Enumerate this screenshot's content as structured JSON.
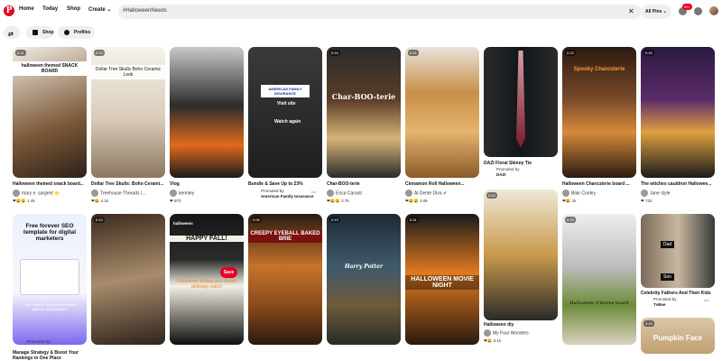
{
  "nav": {
    "home": "Home",
    "today": "Today",
    "shop": "Shop",
    "create": "Create ⌄"
  },
  "search": {
    "value": "#HalloweenNeeds",
    "clear": "✕",
    "scope": "All Pins ⌄"
  },
  "notifications": {
    "badge": "99+"
  },
  "filters": {
    "shop": "Shop",
    "profiles": "Profiles"
  },
  "pins": [
    {
      "dur": "0:11",
      "title": "Halloween themed snack board...",
      "user": "mary e. sargent 🌟",
      "react": "❤😄😮 1.4k",
      "cap": "halloween themed SNACK BOARD"
    },
    {
      "dur": "0:13",
      "title": "Dollar Tree Skulls: Boho Cerami...",
      "user": "Treehouse Threads /...",
      "react": "❤😄 4.1k",
      "cap": "Dollar Tree Skulls Boho Ceramic Look"
    },
    {
      "dur": "",
      "title": "Vlog",
      "user": "kennley",
      "react": "❤ 970",
      "cap": ""
    },
    {
      "dur": "",
      "title": "Bundle & Save Up to 23%",
      "promo": "Promoted by",
      "promo_by": "American Family Insurance",
      "visit": "Visit site",
      "watch": "Watch again",
      "cap": "AMERICAN FAMILY INSURANCE"
    },
    {
      "dur": "0:16",
      "title": "Char-BOO-terie",
      "user": "Erica Canant",
      "react": "❤😄😮 2.7k",
      "cap": "Char-BOO-terie"
    },
    {
      "dur": "0:41",
      "title": "Cinnamon Roll Halloween...",
      "user": "Al Dente Diva ✔",
      "react": "❤😄😮 4.8k",
      "cap": ""
    },
    {
      "dur": "",
      "title": "DAZI Floral Skinny Tie",
      "promo": "Promoted by",
      "promo_by": "DAZI",
      "cap": ""
    },
    {
      "dur": "0:22",
      "title": "Halloween Charcuterie board ...",
      "user": "Blair Cooley",
      "react": "❤😄 1k",
      "cap": "Spooky Charcuterie"
    },
    {
      "dur": "0:40",
      "title": "The witches cauldron Hallowee...",
      "user": "Jane style",
      "react": "❤ 732",
      "cap": ""
    },
    {
      "cap": "Free forever SEO template for digital marketers",
      "sub": "Plan Posts & Track Performance Without Spreadsheets",
      "title": "Manage Strategy & Boost Your Rankings in One Place",
      "promo": "Promoted by"
    },
    {
      "dur": "0:10",
      "cap": ""
    },
    {
      "dur": "",
      "cap": "halloween",
      "cap2": "HAPPY FALL!",
      "cap3": "Halloween Movies you should definitely watch",
      "save": "Save"
    },
    {
      "dur": "0:06",
      "cap": "CREEPY EYEBALL BAKED BRIE"
    },
    {
      "dur": "0:19",
      "cap": "Harry Potter"
    },
    {
      "dur": "0:31",
      "cap": "HALLOWEEN MOVIE NIGHT"
    },
    {
      "dur": "0:15",
      "title": "Halloween diy",
      "user": "My Four Wonders",
      "react": "❤😄 3.1k"
    },
    {
      "dur": "0:25",
      "cap": "Halloween S'mores board"
    },
    {
      "dur": "",
      "title": "Celebrity Fathers And Their Kids",
      "promo": "Promoted by",
      "promo_by": "TvBee",
      "cap": "Dad",
      "cap2": "Son"
    },
    {
      "dur": "0:29",
      "cap": "Pumpkin Face"
    }
  ]
}
